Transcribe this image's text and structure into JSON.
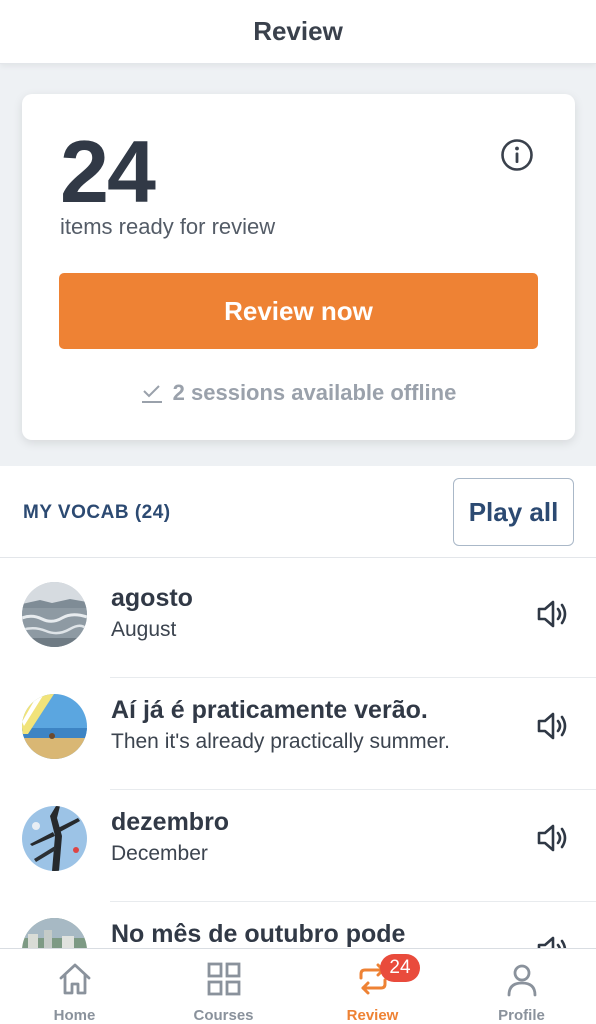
{
  "header": {
    "title": "Review"
  },
  "summary": {
    "count": "24",
    "label": "items ready for review",
    "review_button": "Review now",
    "offline_text": "2 sessions available offline",
    "info_icon": "info-circle-icon",
    "offline_icon": "download-check-icon"
  },
  "vocab": {
    "title": "MY VOCAB (24)",
    "play_all": "Play all",
    "items": [
      {
        "word": "agosto",
        "translation": "August",
        "image": "beach-waves-photo",
        "icon": "speaker-icon"
      },
      {
        "word": "Aí já é praticamente verão.",
        "translation": "Then it's already practically summer.",
        "image": "beach-umbrella-photo",
        "icon": "speaker-icon"
      },
      {
        "word": "dezembro",
        "translation": "December",
        "image": "tree-branches-photo",
        "icon": "speaker-icon"
      },
      {
        "word": "No mês de outubro pode",
        "translation": "",
        "image": "city-photo",
        "icon": "speaker-icon"
      }
    ]
  },
  "nav": {
    "items": [
      {
        "label": "Home",
        "icon": "home-icon",
        "active": false
      },
      {
        "label": "Courses",
        "icon": "grid-icon",
        "active": false
      },
      {
        "label": "Review",
        "icon": "refresh-icon",
        "active": true,
        "badge": "24"
      },
      {
        "label": "Profile",
        "icon": "user-icon",
        "active": false
      }
    ]
  },
  "colors": {
    "accent": "#ee8234",
    "badge": "#e94b3c",
    "heading_blue": "#2c4a72",
    "muted": "#9aa1ab"
  }
}
